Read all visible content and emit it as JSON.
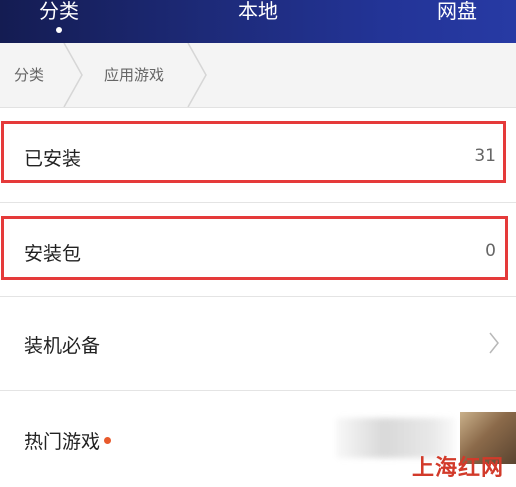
{
  "tabs": {
    "classify": "分类",
    "local": "本地",
    "cloud": "网盘",
    "active": "classify"
  },
  "breadcrumb": {
    "items": [
      "分类",
      "应用游戏"
    ]
  },
  "list": {
    "installed": {
      "label": "已安装",
      "count": "31"
    },
    "packages": {
      "label": "安装包",
      "count": "0"
    },
    "essentials": {
      "label": "装机必备"
    },
    "hot_games": {
      "label": "热门游戏"
    }
  },
  "watermark": "上海红网",
  "colors": {
    "header_dark": "#141c52",
    "header_light": "#273aa4",
    "highlight_red": "#e53a3a",
    "dot_orange": "#e85a2c"
  },
  "icons": {
    "row_chevron": "chevron-right-icon",
    "breadcrumb_separator": "chevron-right-icon"
  }
}
